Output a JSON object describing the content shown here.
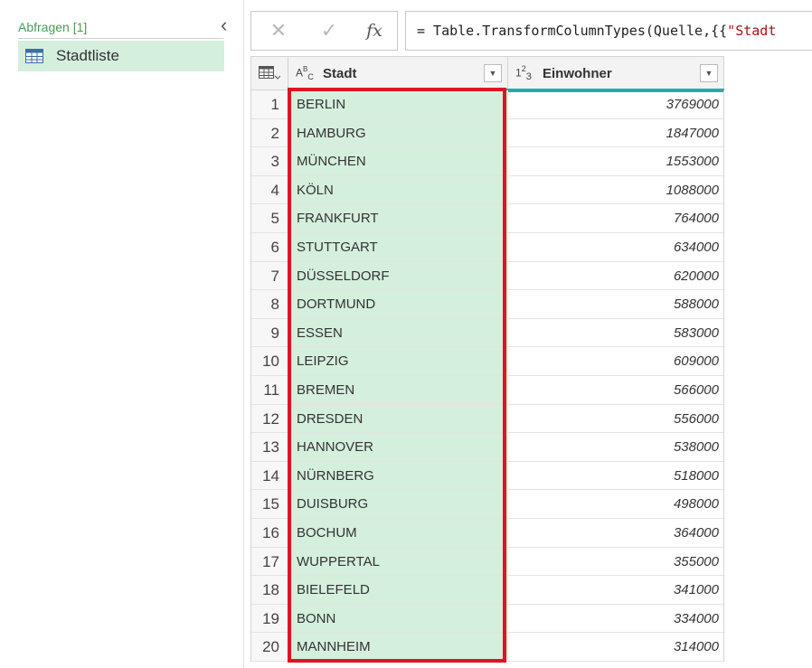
{
  "queries": {
    "header": "Abfragen [1]",
    "items": [
      {
        "label": "Stadtliste",
        "icon": "table-icon"
      }
    ]
  },
  "formula_bar": {
    "prefix": "= Table.TransformColumnTypes(Quelle,{{",
    "string_part": "\"Stadt",
    "fx_label": "fx"
  },
  "grid": {
    "columns": [
      {
        "name": "Stadt",
        "type_icon": "ABC",
        "type": "text"
      },
      {
        "name": "Einwohner",
        "type_icon": "123",
        "type": "number"
      }
    ],
    "rows": [
      {
        "n": "1",
        "city": "BERLIN",
        "pop": "3769000"
      },
      {
        "n": "2",
        "city": "HAMBURG",
        "pop": "1847000"
      },
      {
        "n": "3",
        "city": "MÜNCHEN",
        "pop": "1553000"
      },
      {
        "n": "4",
        "city": "KÖLN",
        "pop": "1088000"
      },
      {
        "n": "5",
        "city": "FRANKFURT",
        "pop": "764000"
      },
      {
        "n": "6",
        "city": "STUTTGART",
        "pop": "634000"
      },
      {
        "n": "7",
        "city": "DÜSSELDORF",
        "pop": "620000"
      },
      {
        "n": "8",
        "city": "DORTMUND",
        "pop": "588000"
      },
      {
        "n": "9",
        "city": "ESSEN",
        "pop": "583000"
      },
      {
        "n": "10",
        "city": "LEIPZIG",
        "pop": "609000"
      },
      {
        "n": "11",
        "city": "BREMEN",
        "pop": "566000"
      },
      {
        "n": "12",
        "city": "DRESDEN",
        "pop": "556000"
      },
      {
        "n": "13",
        "city": "HANNOVER",
        "pop": "538000"
      },
      {
        "n": "14",
        "city": "NÜRNBERG",
        "pop": "518000"
      },
      {
        "n": "15",
        "city": "DUISBURG",
        "pop": "498000"
      },
      {
        "n": "16",
        "city": "BOCHUM",
        "pop": "364000"
      },
      {
        "n": "17",
        "city": "WUPPERTAL",
        "pop": "355000"
      },
      {
        "n": "18",
        "city": "BIELEFELD",
        "pop": "341000"
      },
      {
        "n": "19",
        "city": "BONN",
        "pop": "334000"
      },
      {
        "n": "20",
        "city": "MANNHEIM",
        "pop": "314000"
      }
    ]
  },
  "colors": {
    "selected_column": "#d5efdd",
    "highlight_border": "#e0141f",
    "quality_bar": "#1bb0a0",
    "header_text_green": "#4a9a5a"
  }
}
